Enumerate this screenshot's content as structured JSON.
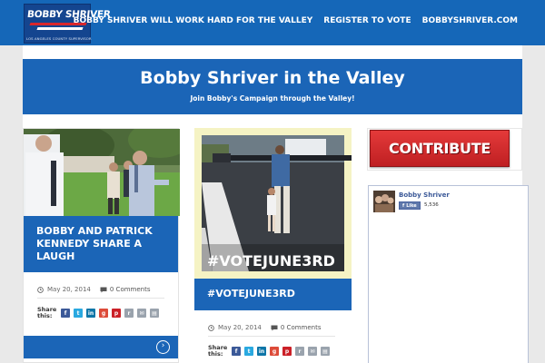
{
  "header": {
    "logo": {
      "name": "BOBBY SHRIVER",
      "subtitle": "LOS ANGELES COUNTY SUPERVISOR"
    },
    "nav": [
      {
        "label": "BOBBY SHRIVER WILL WORK HARD FOR THE VALLEY"
      },
      {
        "label": "REGISTER TO VOTE"
      },
      {
        "label": "BOBBYSHRIVER.COM"
      }
    ]
  },
  "hero": {
    "title": "Bobby Shriver in the Valley",
    "subtitle": "Join Bobby's Campaign through the Valley!"
  },
  "posts": [
    {
      "title": "BOBBY AND PATRICK KENNEDY SHARE A LAUGH",
      "date": "May 20, 2014",
      "comments": "0 Comments",
      "share_label": "Share this:",
      "image": "outdoor-group-photo"
    },
    {
      "title": "#VOTEJUNE3RD",
      "image_caption": "#VOTEJUNE3RD",
      "date": "May 20, 2014",
      "comments": "0 Comments",
      "share_label": "Share this:",
      "image": "father-daughter-crosswalk-photo"
    }
  ],
  "share_icons": [
    {
      "name": "facebook-icon",
      "glyph": "f",
      "color": "#3b5998"
    },
    {
      "name": "twitter-icon",
      "glyph": "t",
      "color": "#2aa9e0"
    },
    {
      "name": "linkedin-icon",
      "glyph": "in",
      "color": "#0e76a8"
    },
    {
      "name": "google-plus-icon",
      "glyph": "g",
      "color": "#dd4b39"
    },
    {
      "name": "pinterest-icon",
      "glyph": "p",
      "color": "#cb2027"
    },
    {
      "name": "reddit-icon",
      "glyph": "r",
      "color": "#9aa3ad"
    },
    {
      "name": "email-icon",
      "glyph": "✉",
      "color": "#9aa3ad"
    },
    {
      "name": "print-icon",
      "glyph": "▤",
      "color": "#9aa3ad"
    }
  ],
  "sidebar": {
    "contribute_label": "CONTRIBUTE",
    "facebook": {
      "page_name": "Bobby Shriver",
      "like_label": "Like",
      "like_count": "5,536"
    }
  },
  "colors": {
    "brand_blue": "#1b65b7",
    "topbar_blue": "#1567b8",
    "contribute_red": "#d42f30",
    "page_bg": "#e9e9e9"
  }
}
